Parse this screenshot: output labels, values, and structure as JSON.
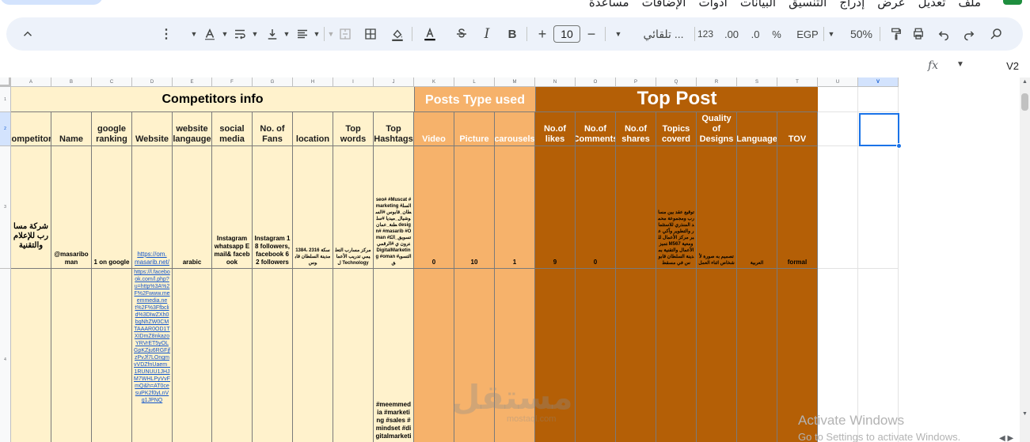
{
  "menu": {
    "items": [
      "ملف",
      "تعديل",
      "عرض",
      "إدراج",
      "التنسيق",
      "البيانات",
      "ادوات",
      "الإضافات",
      "مساعدة"
    ]
  },
  "toolbar": {
    "zoom": "50%",
    "currency": "EGP",
    "percent": "%",
    "decimal_decrease": ".0",
    "decimal_increase": ".00",
    "number_format": "123",
    "font_family": "تلقائي ...",
    "font_size": "10",
    "minus": "−",
    "plus": "+"
  },
  "formula_bar": {
    "fx": "fx",
    "cell_ref": "V2"
  },
  "columns": [
    "A",
    "B",
    "C",
    "D",
    "E",
    "F",
    "G",
    "H",
    "I",
    "J",
    "K",
    "L",
    "M",
    "N",
    "O",
    "P",
    "Q",
    "R",
    "S",
    "T",
    "U",
    "V"
  ],
  "rows": [
    "1",
    "2",
    "3",
    "4"
  ],
  "sheet": {
    "competitors_info": "Competitors info",
    "posts_type_used": "Posts  Type  used",
    "top_post": "Top Post",
    "headers": {
      "A": "Competitors",
      "B": "Name",
      "C": "google ranking",
      "D": "Website",
      "E": "website langauge",
      "F": "social media",
      "G": "No. of Fans",
      "H": "location",
      "I": "Top words",
      "J": "Top Hashtags",
      "K": "Video",
      "L": "Picture",
      "M": "carousels",
      "N": "No.of likes",
      "O": "No.of Comments",
      "P": "No.of shares",
      "Q": "Topics coverd",
      "R": "Quality of Designs",
      "S": "Language",
      "T": "TOV"
    },
    "row3": {
      "A": "شركة مسارب للإعلام والتقنية",
      "B": "@masaribo man",
      "C": "1 on google",
      "D": "https://om. masarib.net/",
      "E": "arabic",
      "F": "Instagram whatsapp Email& facebook",
      "G": "Instagram 18 followers, facebook 62 followers",
      "H": "1384، سكة 2316 مدينة السلطان قابوس",
      "I": "مركز مسارب التعليمي تدريب الأعمال Technology",
      "J": "seo# #Muscat #marketing #السلطان_قابوس #السوشيال_ميديا #سلطنة_عمان design# #masarib #Oman #تسويق_الكترون ي #الرقمي DigitalMarketing #oman #التسويق",
      "K": "0",
      "L": "10",
      "M": "1",
      "N": "9",
      "O": "0",
      "Q": "توقيع عقد بين مسارب ومجموعة محمد المنذري للاستثمار والتطوير وآكي عبر مركز الأعمال للتميز M567 ومعية الأعمال والتقنية بمدينة السلطان قابوس في مسقط",
      "R": "تصميم به صورة لأشخاص اثناء العمل",
      "S": "العربية",
      "T": "formal"
    },
    "row4": {
      "D": "https://l.facebook.com/l.php?u=http%3A%2F%2Fwww.meemmedia.net%2F%3Ffbclid%3DIwZXh0bgNhZW0CMTAAAR0OD1TXIDmZ8nkazoYRVrET5yOLGpKZju6RGFjfzPvJf7LOngmvVDZfnUaem_1RUNUU1JHJM7WHLPyVvFmQ&h=AT0cesuPK2f0yLnVg1JPNQ",
      "J": "#meemmedia #marketing #sales #mindset #digitalmarketing"
    }
  },
  "watermark": {
    "text": "مستقل",
    "sub": "mostaql.com"
  },
  "activate": {
    "title": "Activate Windows",
    "sub": "Go to Settings to activate Windows."
  },
  "colors": {
    "cream": "#fff2cc",
    "orange": "#f6b26b",
    "brown": "#b45f06",
    "toolbar": "#edf2fa",
    "selection": "#1a73e8"
  }
}
